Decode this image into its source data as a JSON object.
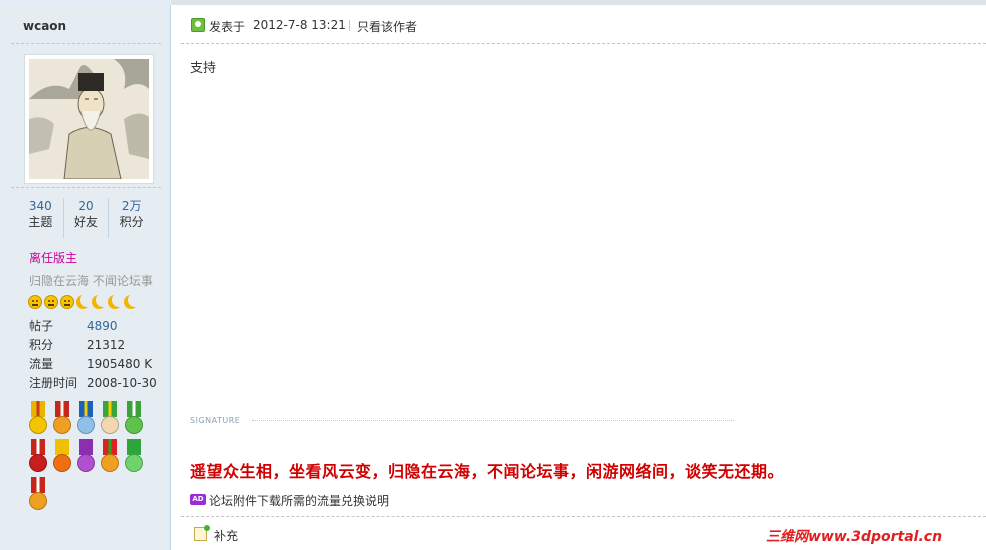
{
  "user": {
    "name": "wcaon",
    "stats": [
      {
        "value": "340",
        "label": "主题"
      },
      {
        "value": "20",
        "label": "好友"
      },
      {
        "value": "2万",
        "label": "积分"
      }
    ],
    "rank": "离任版主",
    "motto": "归隐在云海  不闻论坛事",
    "profile": [
      {
        "key": "帖子",
        "value": "4890",
        "link": true
      },
      {
        "key": "积分",
        "value": "21312",
        "link": false
      },
      {
        "key": "流量",
        "value": "1905480 K",
        "link": false
      },
      {
        "key": "注册时间",
        "value": "2008-10-30",
        "link": false
      }
    ]
  },
  "post": {
    "posted_label": "发表于",
    "posted_time": "2012-7-8 13:21",
    "only_author": "只看该作者",
    "body": "支持",
    "signature_label": "SIGNATURE",
    "signature_text": "遥望众生相，坐看风云变，归隐在云海，不闻论坛事，闲游网络间，谈笑无还期。",
    "ad_badge": "AD",
    "ad_link": "论坛附件下载所需的流量兑换说明",
    "supplement": "补充"
  },
  "watermark": "三维网www.3dportal.cn",
  "colors": {
    "sidebar_bg": "#e5edf2",
    "link": "#336699",
    "rank": "#cc0099",
    "signature": "#d10000"
  }
}
